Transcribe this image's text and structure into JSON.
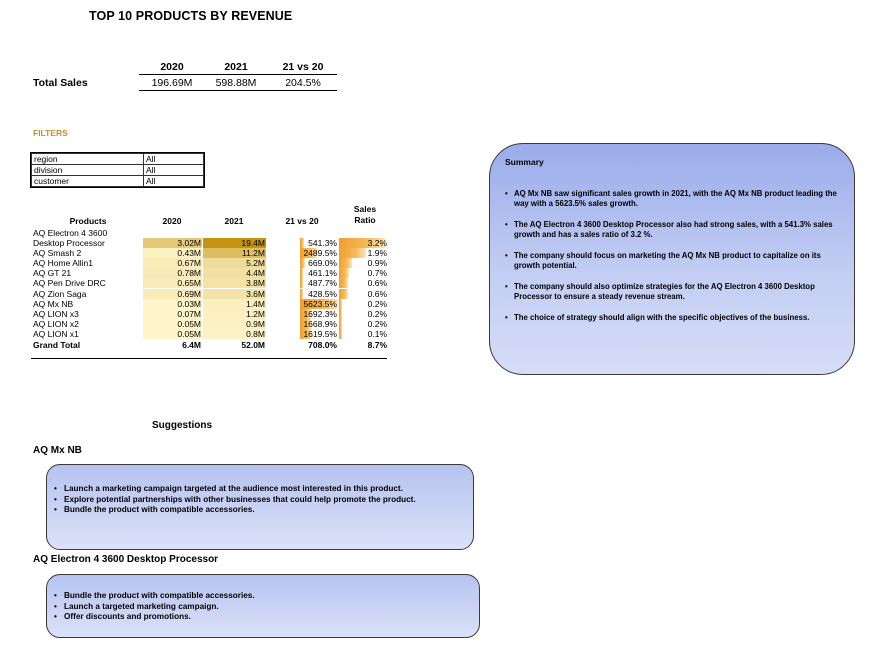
{
  "title": "TOP 10 PRODUCTS BY REVENUE",
  "total_sales": {
    "label": "Total Sales",
    "headers": [
      "2020",
      "2021",
      "21 vs 20"
    ],
    "values": [
      "196.69M",
      "598.88M",
      "204.5%"
    ]
  },
  "filters": {
    "title": "FILTERS",
    "rows": [
      {
        "key": "region",
        "value": "All"
      },
      {
        "key": "division",
        "value": "All"
      },
      {
        "key": "customer",
        "value": "All"
      }
    ]
  },
  "pivot": {
    "headers": {
      "products": "Products",
      "y2020": "2020",
      "y2021": "2021",
      "vs": "21 vs 20",
      "ratio_line1": "Sales",
      "ratio_line2": "Ratio"
    },
    "rows": [
      {
        "name": "AQ Electron 4 3600 Desktop Processor",
        "y2020": "3.02M",
        "y2021": "19.4M",
        "vs": "541.3%",
        "ratio": "3.2%"
      },
      {
        "name": "AQ Smash 2",
        "y2020": "0.43M",
        "y2021": "11.2M",
        "vs": "2489.5%",
        "ratio": "1.9%"
      },
      {
        "name": "AQ Home Allin1",
        "y2020": "0.67M",
        "y2021": "5.2M",
        "vs": "669.0%",
        "ratio": "0.9%"
      },
      {
        "name": "AQ GT 21",
        "y2020": "0.78M",
        "y2021": "4.4M",
        "vs": "461.1%",
        "ratio": "0.7%"
      },
      {
        "name": "AQ Pen Drive DRC",
        "y2020": "0.65M",
        "y2021": "3.8M",
        "vs": "487.7%",
        "ratio": "0.6%"
      },
      {
        "name": "AQ Zion Saga",
        "y2020": "0.69M",
        "y2021": "3.6M",
        "vs": "428.5%",
        "ratio": "0.6%"
      },
      {
        "name": "AQ Mx NB",
        "y2020": "0.03M",
        "y2021": "1.4M",
        "vs": "5623.5%",
        "ratio": "0.2%"
      },
      {
        "name": "AQ LION x3",
        "y2020": "0.07M",
        "y2021": "1.2M",
        "vs": "1692.3%",
        "ratio": "0.2%"
      },
      {
        "name": "AQ LION x2",
        "y2020": "0.05M",
        "y2021": "0.9M",
        "vs": "1668.9%",
        "ratio": "0.2%"
      },
      {
        "name": "AQ LION x1",
        "y2020": "0.05M",
        "y2021": "0.8M",
        "vs": "1619.5%",
        "ratio": "0.1%"
      }
    ],
    "grand_total": {
      "name": "Grand Total",
      "y2020": "6.4M",
      "y2021": "52.0M",
      "vs": "708.0%",
      "ratio": "8.7%"
    },
    "colors": {
      "heat_low": "#fff6cc",
      "heat_high": "#c59211",
      "bar": "#f5b955",
      "bar_edge": "#f0a030"
    }
  },
  "summary": {
    "title": "Summary",
    "bullets": [
      "AQ Mx NB saw significant sales growth in 2021, with the AQ Mx NB product leading the way with a 5623.5% sales growth.",
      "The AQ Electron 4 3600 Desktop Processor also had strong sales, with a 541.3% sales growth and has a sales ratio of 3.2 %.",
      "The company should focus on marketing the AQ Mx NB product to capitalize on its growth potential.",
      "The company should also optimize strategies for the AQ Electron 4 3600 Desktop Processor to ensure a steady revenue stream.",
      "The choice of strategy should align with the specific objectives of the business."
    ]
  },
  "suggestions": {
    "title": "Suggestions",
    "groups": [
      {
        "product": "AQ Mx NB",
        "items": [
          "Launch a marketing campaign targeted at the audience most interested in this product.",
          "Explore potential partnerships with other businesses that could help promote the product.",
          "Bundle the product with compatible accessories."
        ]
      },
      {
        "product": "AQ Electron 4 3600 Desktop Processor",
        "items": [
          "Bundle the product with compatible accessories.",
          "Launch a targeted marketing campaign.",
          "Offer discounts and promotions."
        ]
      }
    ]
  }
}
